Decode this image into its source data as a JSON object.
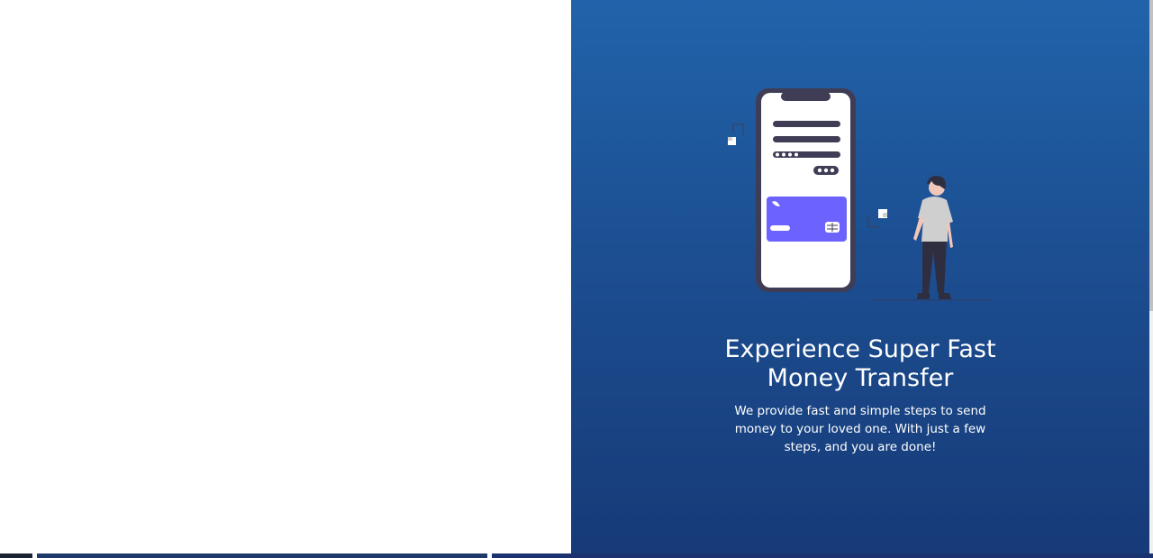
{
  "hero": {
    "headline_line1": "Experience Super Fast",
    "headline_line2": "Money Transfer",
    "subtext": "We provide fast and simple steps to send money to your loved one. With just a few steps, and you are done!"
  },
  "illustration": {
    "icon": "phone-payment-illustration",
    "card_color": "#6c63ff",
    "phone_frame_color": "#3f3d56"
  },
  "colors": {
    "panel_gradient_top": "#2163aa",
    "panel_gradient_bottom": "#173a78",
    "left_panel": "#ffffff"
  }
}
